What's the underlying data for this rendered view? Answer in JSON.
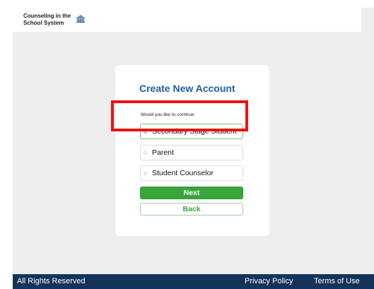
{
  "header": {
    "logo_line1": "Counseling in the",
    "logo_line2": "School System",
    "logo_icon": "school-building-icon"
  },
  "card": {
    "title": "Create New Account",
    "question": "Would you like to continue",
    "options": [
      {
        "label": "Secondary Stage Student",
        "selected": true
      },
      {
        "label": "Parent",
        "selected": false
      },
      {
        "label": "Student Counselor",
        "selected": false
      }
    ],
    "next_label": "Next",
    "back_label": "Back"
  },
  "footer": {
    "rights": "All Rights Reserved",
    "privacy": "Privacy Policy",
    "terms": "Terms of Use"
  },
  "colors": {
    "title": "#1f5ea0",
    "button_green": "#3aa53a",
    "footer_bg": "#14335a",
    "highlight": "#ee1111"
  }
}
